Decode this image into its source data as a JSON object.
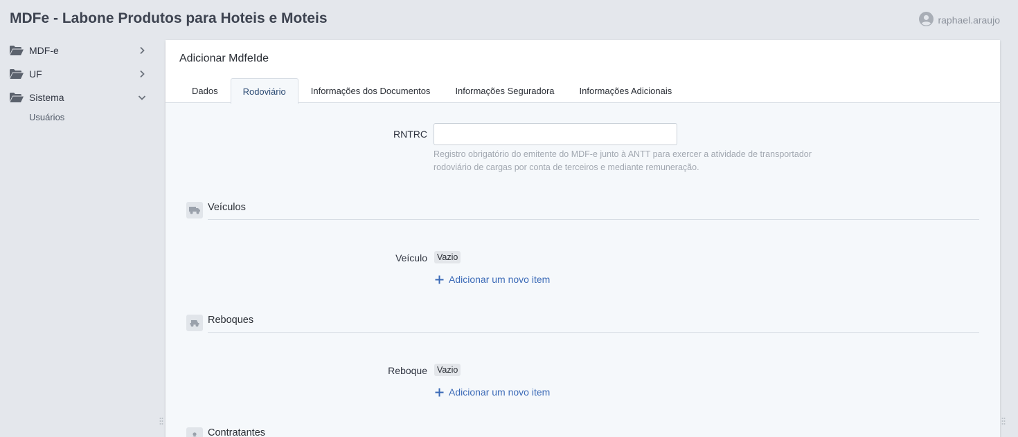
{
  "app": {
    "title": "MDFe - Labone Produtos para Hoteis e Moteis"
  },
  "user": {
    "name": "raphael.araujo"
  },
  "sidebar": {
    "items": [
      {
        "label": "MDF-e"
      },
      {
        "label": "UF"
      },
      {
        "label": "Sistema"
      }
    ],
    "sub_items": [
      {
        "label": "Usuários"
      }
    ]
  },
  "panel": {
    "title": "Adicionar MdfeIde",
    "tabs": [
      {
        "label": "Dados"
      },
      {
        "label": "Rodoviário"
      },
      {
        "label": "Informações dos Documentos"
      },
      {
        "label": "Informações Seguradora"
      },
      {
        "label": "Informações Adicionais"
      }
    ],
    "active_tab": "Rodoviário"
  },
  "form": {
    "rntrc": {
      "label": "RNTRC",
      "value": "",
      "help": "Registro obrigatório do emitente do MDF-e junto à ANTT para exercer a atividade de transportador rodoviário de cargas por conta de terceiros e mediante remuneração."
    },
    "veiculos": {
      "section_title": "Veículos",
      "field_label": "Veículo",
      "empty_badge": "Vazio",
      "add_label": "Adicionar um novo item"
    },
    "reboques": {
      "section_title": "Reboques",
      "field_label": "Reboque",
      "empty_badge": "Vazio",
      "add_label": "Adicionar um novo item"
    },
    "contratantes": {
      "section_title": "Contratantes"
    }
  },
  "icons": {
    "folder": "folder-open-icon",
    "chevron_right": "chevron-right-icon",
    "chevron_down": "chevron-down-icon",
    "user": "user-circle-icon",
    "truck": "truck-icon",
    "trailer": "trailer-icon",
    "person": "person-icon",
    "plus": "plus-icon"
  },
  "colors": {
    "background": "#e4e7ec",
    "panel": "#f5f8fb",
    "link": "#3b6ab7",
    "title": "#3d4350"
  }
}
